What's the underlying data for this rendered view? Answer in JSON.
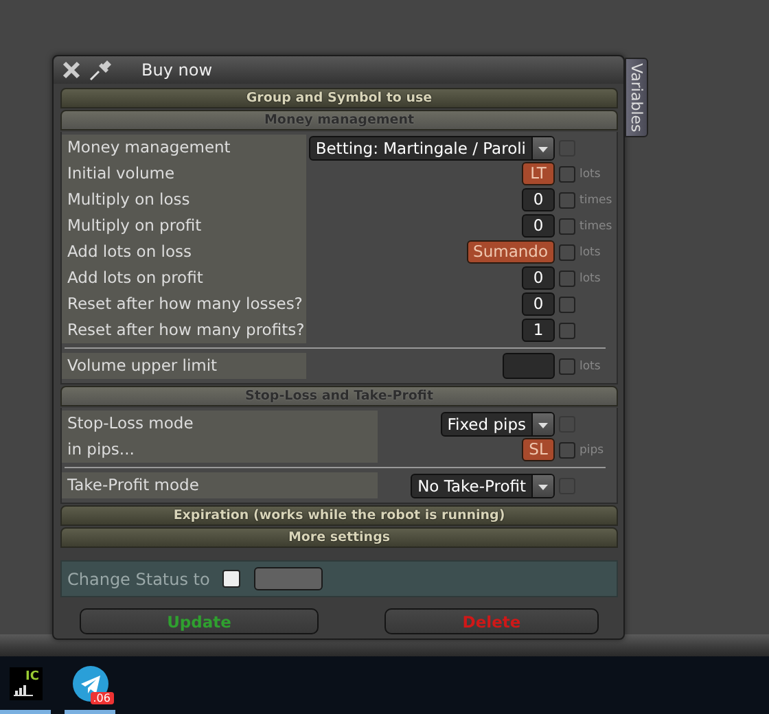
{
  "window": {
    "title": "Buy now"
  },
  "side_tab": {
    "label": "Variables"
  },
  "sections": [
    {
      "title": "Group and Symbol to use",
      "expanded": false
    },
    {
      "title": "Money management",
      "expanded": true,
      "groups": [
        [
          {
            "label": "Money management",
            "kind": "dropdown",
            "value": "Betting: Martingale / Paroli",
            "checked": false
          },
          {
            "label": "Initial volume",
            "kind": "input",
            "value": "LT",
            "highlighted": true,
            "unit": "lots",
            "checked": false
          },
          {
            "label": "Multiply on loss",
            "kind": "input",
            "value": "0",
            "highlighted": false,
            "unit": "times",
            "checked": false
          },
          {
            "label": "Multiply on profit",
            "kind": "input",
            "value": "0",
            "highlighted": false,
            "unit": "times",
            "checked": false
          },
          {
            "label": "Add lots on loss",
            "kind": "input",
            "value": "Sumando",
            "highlighted": true,
            "unit": "lots",
            "checked": false
          },
          {
            "label": "Add lots on profit",
            "kind": "input",
            "value": "0",
            "highlighted": false,
            "unit": "lots",
            "checked": false
          },
          {
            "label": "Reset after how many losses?",
            "kind": "input",
            "value": "0",
            "highlighted": false,
            "checked": false
          },
          {
            "label": "Reset after how many profits?",
            "kind": "input",
            "value": "1",
            "highlighted": false,
            "checked": false
          }
        ],
        [
          {
            "label": "Volume upper limit",
            "kind": "input",
            "highlighted": false,
            "unit": "lots",
            "checked": false
          }
        ]
      ]
    },
    {
      "title": "Stop-Loss and Take-Profit",
      "expanded": true,
      "groups": [
        [
          {
            "label": "Stop-Loss mode",
            "kind": "dropdown",
            "value": "Fixed pips",
            "checked": false
          },
          {
            "label": "in pips...",
            "kind": "input",
            "value": "SL",
            "highlighted": true,
            "unit": "pips",
            "checked": false
          }
        ],
        [
          {
            "label": "Take-Profit mode",
            "kind": "dropdown",
            "value": "No Take-Profit",
            "checked": false
          }
        ]
      ]
    },
    {
      "title": "Expiration (works while the robot is running)",
      "expanded": false
    },
    {
      "title": "More settings",
      "expanded": false
    }
  ],
  "status": {
    "label": "Change Status to",
    "checked": false
  },
  "buttons": [
    {
      "label": "Update",
      "kind": "confirm"
    },
    {
      "label": "Delete",
      "kind": "danger"
    }
  ],
  "taskbar": [
    {
      "kind": "logo",
      "label": "IC",
      "active": true
    },
    {
      "kind": "telegram",
      "badge": ".06",
      "active": true
    }
  ]
}
